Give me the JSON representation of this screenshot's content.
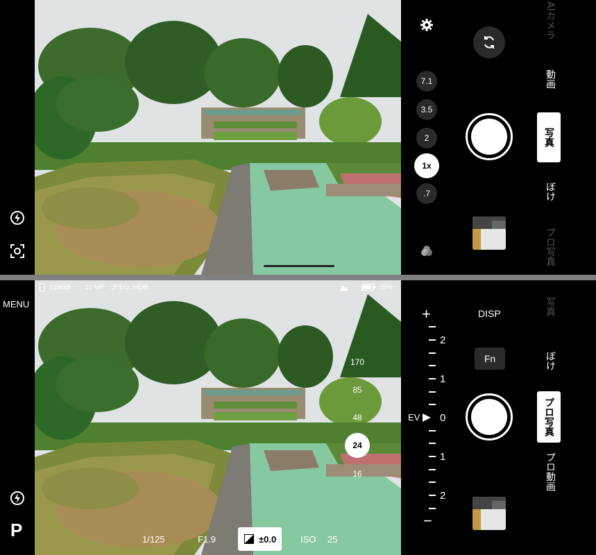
{
  "top_panel": {
    "zoom_levels": [
      "7.1",
      "3.5",
      "2",
      "1x",
      ".7"
    ],
    "modes": [
      "AIカメラ",
      "動画",
      "写真",
      "ぼけ",
      "プロ写真"
    ],
    "active_mode": "写真",
    "icons": {
      "settings": "gear-icon",
      "switch_camera": "camera-switch-icon",
      "flash": "flash-auto-icon",
      "focus": "focus-frame-icon",
      "filter": "color-filter-icon"
    }
  },
  "bottom_panel": {
    "menu_label": "MENU",
    "mode_letter": "P",
    "status": {
      "storage": "228GB",
      "megapixels": "12 MP",
      "format": "JPEG",
      "hdr": "HDR",
      "battery": "78%"
    },
    "iso_options": [
      "170",
      "85",
      "48",
      "24",
      "16"
    ],
    "iso_selected": "24",
    "shutter_speed": "1/125",
    "aperture": "F1.9",
    "ev_value": "±0.0",
    "iso_label": "ISO",
    "iso_value": "25",
    "ev_scale": {
      "plus": "+",
      "minus": "−",
      "label": "EV",
      "marks": [
        "2",
        "1",
        "0",
        "1",
        "2"
      ]
    },
    "disp_label": "DISP",
    "fn_label": "Fn",
    "modes": [
      "写真",
      "ぼけ",
      "プロ写真",
      "プロ動画"
    ],
    "active_mode": "プロ写真"
  },
  "colors": {
    "sky": "#dfe3e4",
    "foliage_dark": "#2e5a24",
    "foliage_mid": "#5a8a34",
    "hedge_pink": "#b9855c",
    "water": "#86c9a1",
    "path": "#7e7a74"
  }
}
